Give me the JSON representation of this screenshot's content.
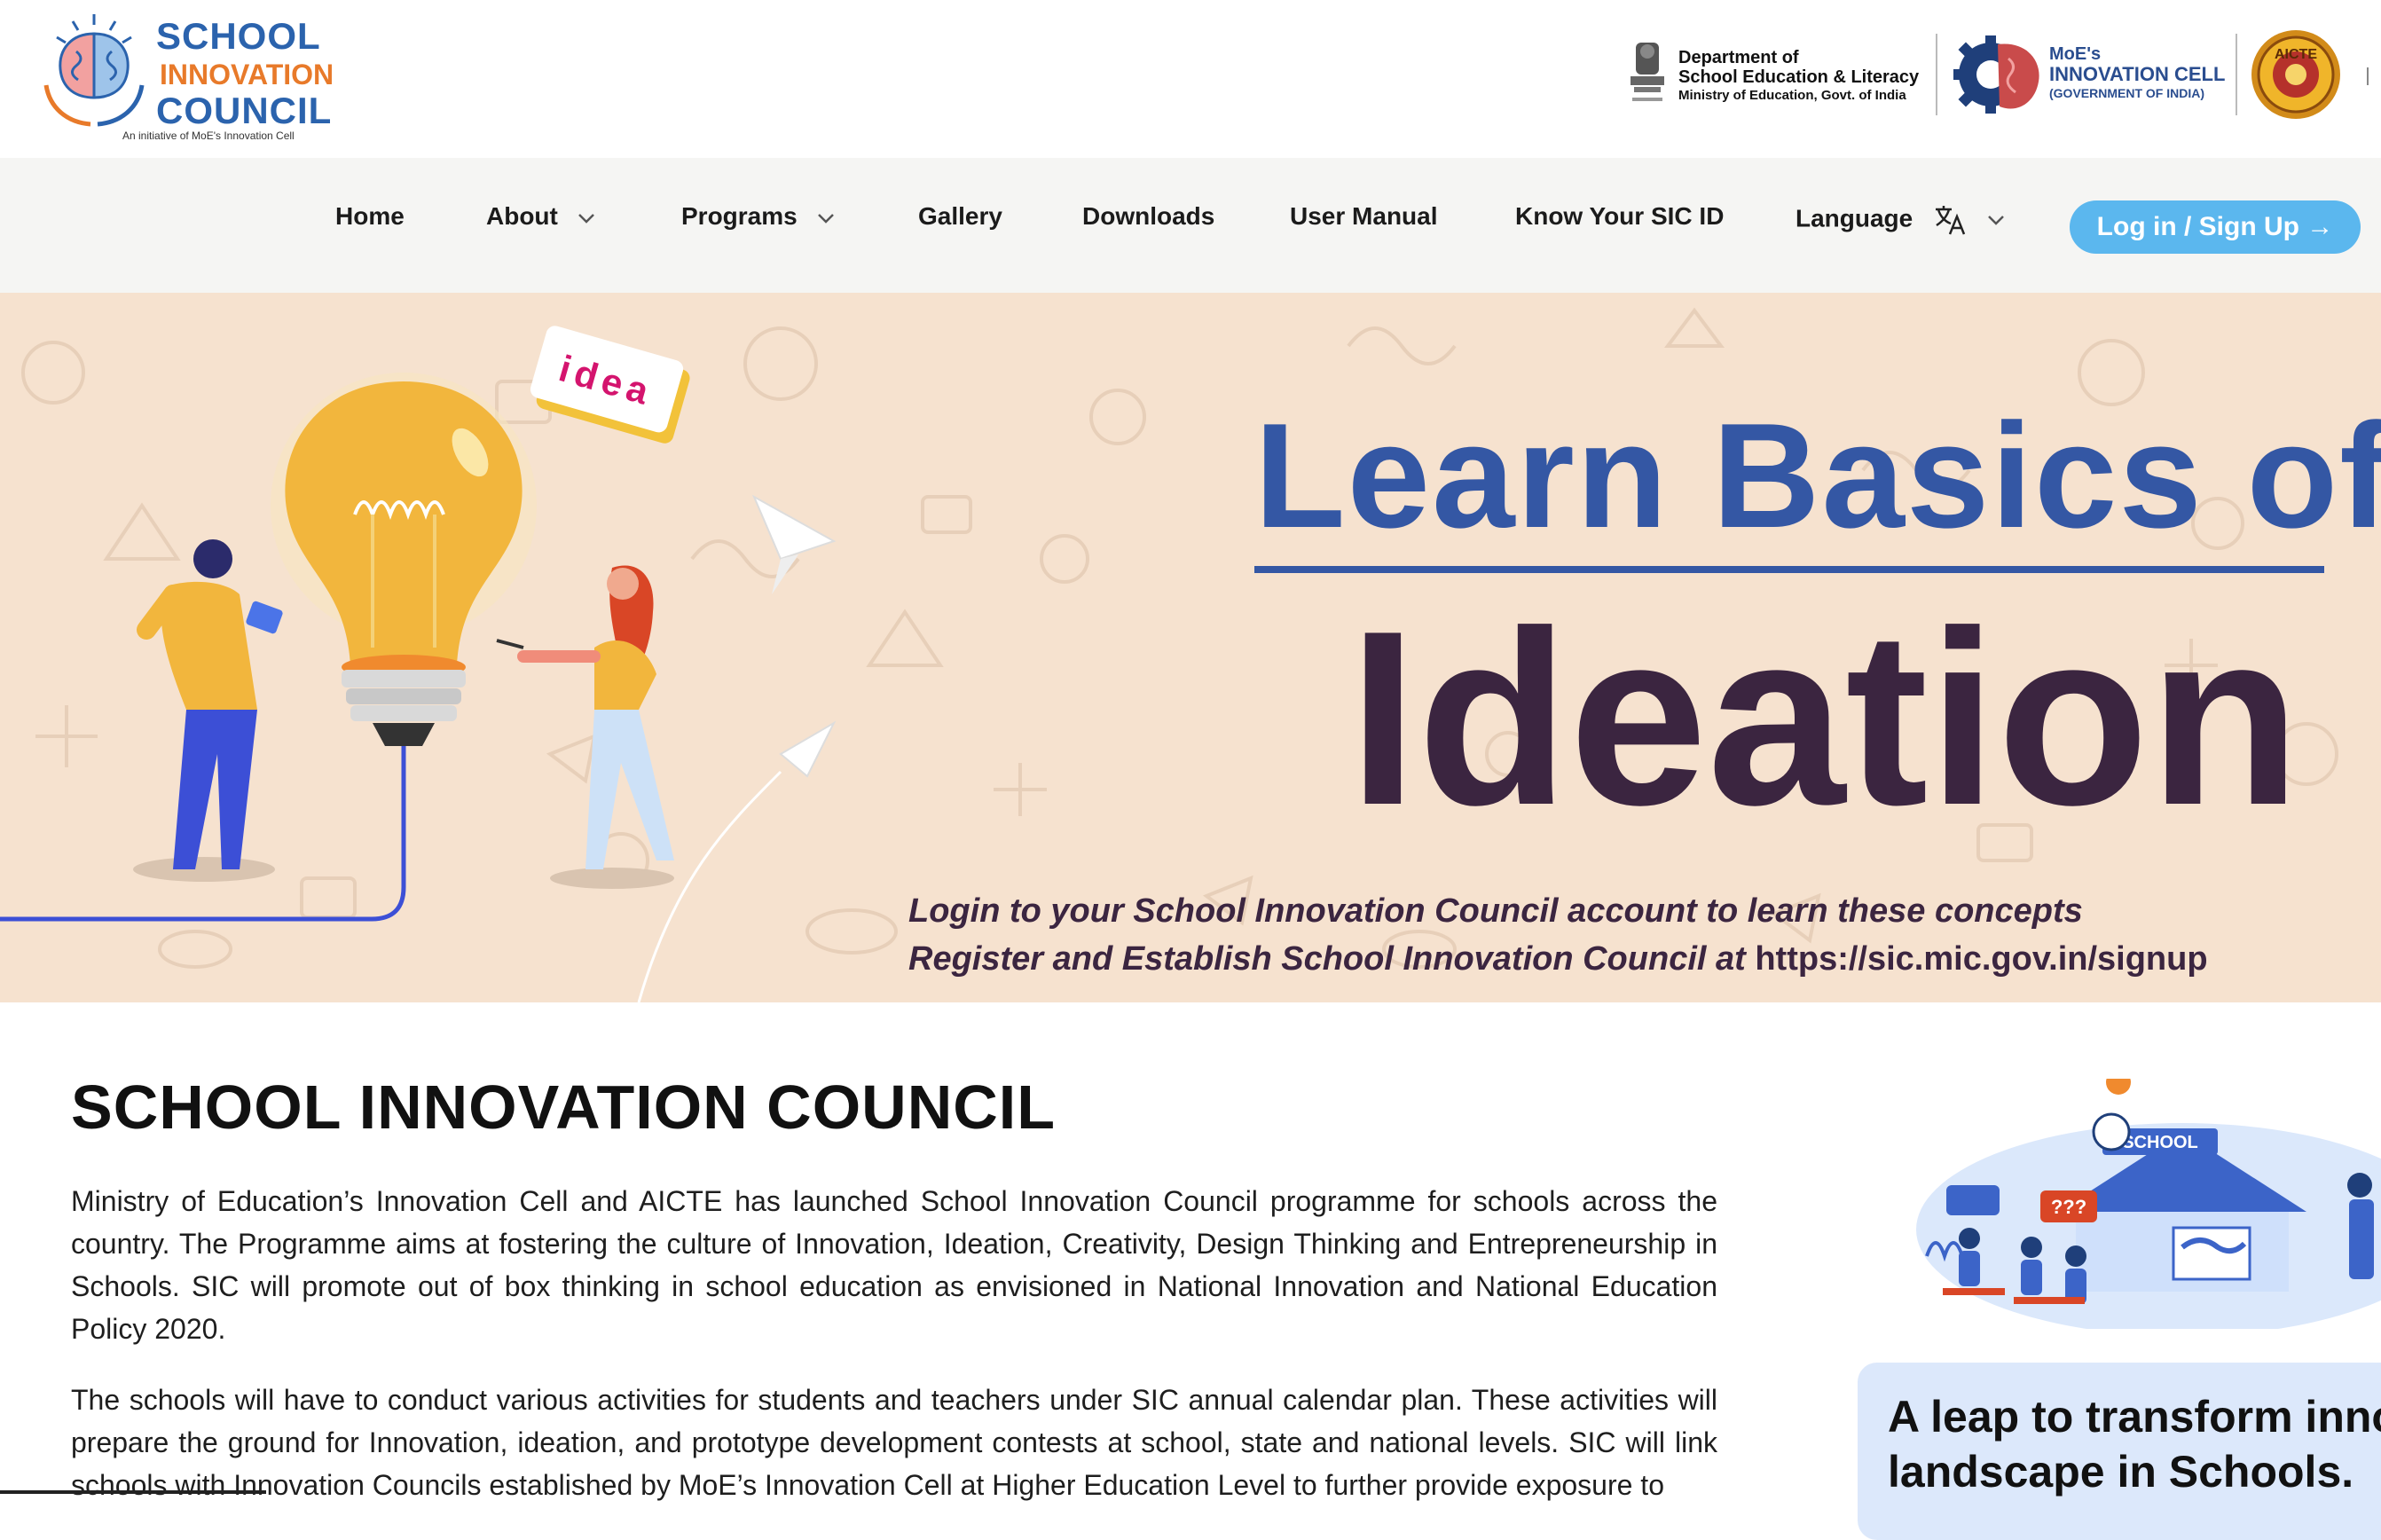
{
  "header": {
    "logo": {
      "line1": "SCHOOL",
      "line2": "INNOVATION",
      "line3": "COUNCIL",
      "tagline": "An initiative of MoE's Innovation Cell"
    },
    "partners": {
      "dept_line1": "Department of",
      "dept_line2": "School Education & Literacy",
      "dept_line3": "Ministry of Education, Govt. of India",
      "moe_line1": "MoE's",
      "moe_line2": "INNOVATION CELL",
      "moe_line3": "(GOVERNMENT OF INDIA)",
      "aicte": "AICTE"
    }
  },
  "nav": {
    "items": [
      {
        "label": "Home",
        "dropdown": false
      },
      {
        "label": "About",
        "dropdown": true
      },
      {
        "label": "Programs",
        "dropdown": true
      },
      {
        "label": "Gallery",
        "dropdown": false
      },
      {
        "label": "Downloads",
        "dropdown": false
      },
      {
        "label": "User Manual",
        "dropdown": false
      },
      {
        "label": "Know Your SIC ID",
        "dropdown": false
      },
      {
        "label": "Language",
        "dropdown": true
      }
    ],
    "login_label": "Log in / Sign Up →"
  },
  "hero": {
    "badge": "idea",
    "title_line1": "Learn Basics of",
    "title_line2": "Ideation",
    "sub_line1": "Login to your School Innovation Council account to learn these concepts",
    "sub_line2_prefix": "Register and Establish School Innovation Council at ",
    "sub_line2_url": "https://sic.mic.gov.in/signup"
  },
  "main": {
    "title": "SCHOOL INNOVATION COUNCIL",
    "para1": "Ministry of Education’s Innovation Cell and AICTE has launched School Innovation Council programme for schools across the country. The Programme aims at fostering the culture of Innovation, Ideation, Creativity, Design Thinking and Entrepreneurship in Schools. SIC will promote out of box thinking in school education as envisioned in National Innovation and National Education Policy 2020.",
    "para2": "The schools will have to conduct various activities for students and teachers under SIC annual calendar plan. These activities will prepare the ground for Innovation, ideation, and prototype development contests at school, state and national levels. SIC will link schools with Innovation Councils established by MoE’s Innovation Cell at Higher Education Level to further provide exposure to"
  },
  "sidebar": {
    "illus_badge": "SCHOOL",
    "illus_marks": "???",
    "card_line1": "A leap to transform innova",
    "card_line2": "landscape in Schools."
  },
  "colors": {
    "brand_blue": "#2b63ad",
    "brand_orange": "#e87a2a",
    "hero_bg": "#f6e2cf",
    "hero_title_blue": "#3457a4",
    "hero_title_dark": "#3b2540",
    "login_button": "#5bb7ee",
    "nav_bg": "#f5f5f3",
    "card_bg": "#dce8fb"
  },
  "icons": [
    "brain-logo-icon",
    "emblem-icon",
    "gear-brain-icon",
    "aicte-seal-icon",
    "chevron-down-icon",
    "translate-icon",
    "arrow-right-icon",
    "lightbulb-icon",
    "paper-plane-icon"
  ]
}
